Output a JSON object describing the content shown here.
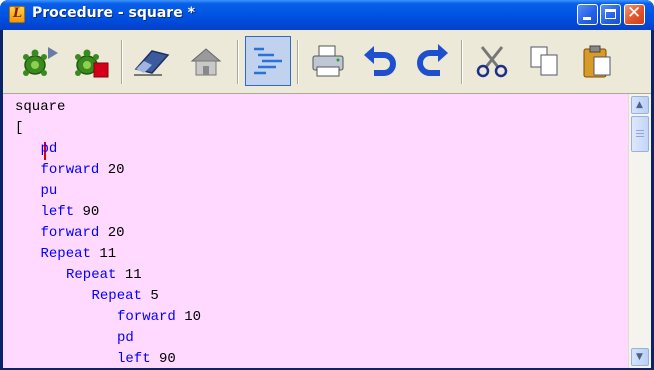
{
  "window": {
    "title": "Procedure - square *",
    "app_icon_letter": "L",
    "controls": [
      "minimize",
      "maximize",
      "close"
    ]
  },
  "toolbar": {
    "buttons": [
      {
        "name": "run-turtle-icon",
        "label": "Run"
      },
      {
        "name": "stop-turtle-icon",
        "label": "Stop"
      },
      {
        "name": "eraser-icon",
        "label": "Clear"
      },
      {
        "name": "home-icon",
        "label": "Home"
      },
      {
        "name": "indent-icon",
        "label": "Indent"
      },
      {
        "name": "printer-icon",
        "label": "Print"
      },
      {
        "name": "undo-icon",
        "label": "Undo"
      },
      {
        "name": "redo-icon",
        "label": "Redo"
      },
      {
        "name": "cut-icon",
        "label": "Cut"
      },
      {
        "name": "copy-icon",
        "label": "Copy"
      },
      {
        "name": "paste-icon",
        "label": "Paste"
      }
    ]
  },
  "editor": {
    "background": "#ffd9ff",
    "keyword_color": "#0000ff",
    "lines": [
      {
        "indent": 0,
        "kw": "square",
        "arg": ""
      },
      {
        "indent": 0,
        "kw": "[",
        "arg": ""
      },
      {
        "indent": 1,
        "kw": "pd",
        "arg": ""
      },
      {
        "indent": 1,
        "kw": "forward",
        "arg": "20"
      },
      {
        "indent": 1,
        "kw": "pu",
        "arg": ""
      },
      {
        "indent": 1,
        "kw": "left",
        "arg": "90"
      },
      {
        "indent": 1,
        "kw": "forward",
        "arg": "20"
      },
      {
        "indent": 1,
        "kw": "Repeat",
        "arg": "11"
      },
      {
        "indent": 2,
        "kw": "Repeat",
        "arg": "11"
      },
      {
        "indent": 3,
        "kw": "Repeat",
        "arg": "5"
      },
      {
        "indent": 4,
        "kw": "forward",
        "arg": "10"
      },
      {
        "indent": 4,
        "kw": "pd",
        "arg": ""
      },
      {
        "indent": 4,
        "kw": "left",
        "arg": "90"
      }
    ]
  }
}
